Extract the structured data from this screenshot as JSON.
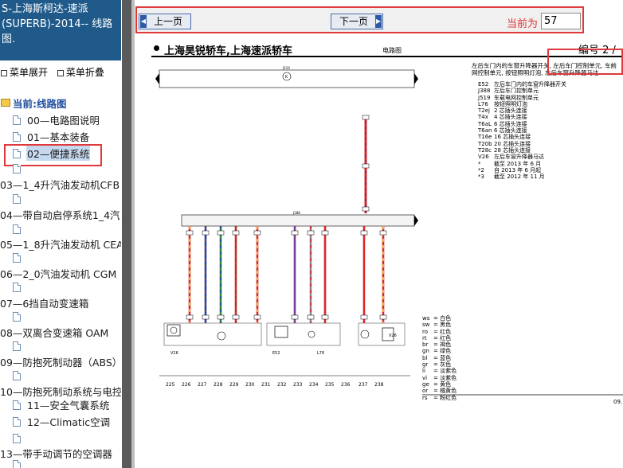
{
  "sidebar": {
    "header_lines": [
      "S-上海斯柯达-速派",
      "(SUPERB)-2014-- 线路",
      "图."
    ],
    "expand_label": "菜单展开",
    "collapse_label": "菜单折叠",
    "current_label": "当前:线路图",
    "items": [
      "00—电路图说明",
      "01—基本装备",
      "02—便捷系统",
      "03—1_4升汽油发动机CFB",
      "04—带自动启停系统1_4汽",
      "05—1_8升汽油发动机 CEA",
      "06—2_0汽油发动机 CGM",
      "07—6挡自动变速箱",
      "08—双离合变速箱 OAM",
      "09—防抱死制动器（ABS）",
      "10—防抱死制动系统与电控",
      "11—安全气囊系统",
      "12—Climatic空调",
      "13—带手动调节的空调器"
    ]
  },
  "toolbar": {
    "prev_label": "上一页",
    "next_label": "下一页",
    "page_label": "当前为",
    "page_value": "57"
  },
  "document": {
    "title": "上海昊锐轿车,上海速派轿车",
    "subtitle": "电路图",
    "number": "编号 2 /",
    "description_lines": [
      "左后车门内的车窗升降器开关, 左后车门控制单元, 车前",
      "网控制单元, 按钮照明灯泡, 左后车窗升降器马达"
    ],
    "components": [
      [
        "E52",
        "左后车门内的车窗升降器开关"
      ],
      [
        "J388",
        "左后车门控制单元"
      ],
      [
        "J519",
        "车载电网控制单元"
      ],
      [
        "L76",
        "按钮照明灯泡"
      ],
      [
        "T2ej",
        "2 芯插头连接"
      ],
      [
        "T4x",
        "4 芯插头连接"
      ],
      [
        "T6aL",
        "6 芯插头连接"
      ],
      [
        "T6an",
        "6 芯插头连接"
      ],
      [
        "T16e",
        "16 芯插头连接"
      ],
      [
        "T20b",
        "20 芯插头连接"
      ],
      [
        "T28c",
        "28 芯插头连接"
      ],
      [
        "V26",
        "左后车窗升降器马达"
      ],
      [
        "*",
        "截至 2013 年 6 月"
      ],
      [
        "*2",
        "自 2013 年 6 月起"
      ],
      [
        "*3",
        "截至 2012 年 11 月"
      ]
    ],
    "colors": [
      [
        "ws",
        "白色"
      ],
      [
        "sw",
        "黑色"
      ],
      [
        "ro",
        "红色"
      ],
      [
        "rt",
        "红色"
      ],
      [
        "br",
        "褐色"
      ],
      [
        "gn",
        "绿色"
      ],
      [
        "bl",
        "蓝色"
      ],
      [
        "gr",
        "灰色"
      ],
      [
        "li",
        "淡紫色"
      ],
      [
        "vi",
        "淡紫色"
      ],
      [
        "ge",
        "黄色"
      ],
      [
        "or",
        "橘黄色"
      ],
      [
        "rs",
        "粉红色"
      ]
    ],
    "bus_top_label": "J519",
    "bus_mid_label": "J388",
    "labels_component": [
      "V26",
      "E52",
      "L76",
      "V26"
    ],
    "column_numbers": [
      "225",
      "226",
      "227",
      "228",
      "229",
      "230",
      "231",
      "232",
      "233",
      "234",
      "235",
      "236",
      "237",
      "238"
    ],
    "page_ref": "09."
  },
  "wire_colors": {
    "red": "#d8262a",
    "yellow": "#e9d22a",
    "blue": "#2540a8",
    "brown": "#7a4a1e",
    "green": "#2a8a3a",
    "purple": "#7a3a9a",
    "gray": "#8a8a8a"
  }
}
